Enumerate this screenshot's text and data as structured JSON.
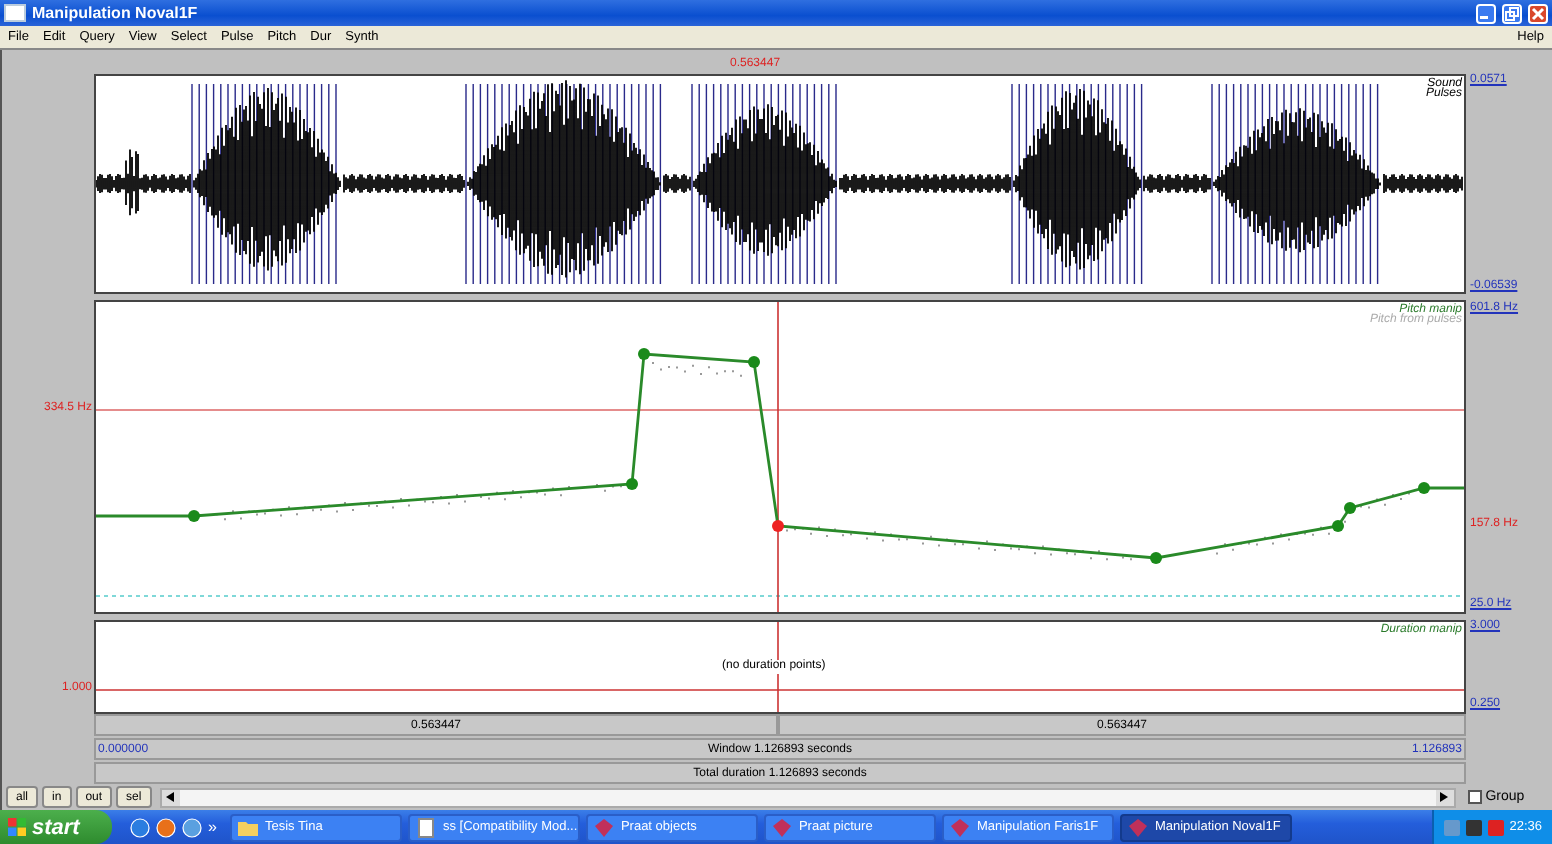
{
  "window": {
    "title": "Manipulation Noval1F"
  },
  "menu": {
    "items": [
      "File",
      "Edit",
      "Query",
      "View",
      "Select",
      "Pulse",
      "Pitch",
      "Dur",
      "Synth"
    ],
    "help": "Help"
  },
  "cursor_time": "0.563447",
  "sound_panel": {
    "labels": [
      "Sound",
      "Pulses"
    ],
    "max": "0.0571",
    "min": "-0.06539"
  },
  "pitch_panel": {
    "labels": [
      "Pitch manip",
      "Pitch from pulses"
    ],
    "max": "601.8 Hz",
    "cursor_value": "334.5 Hz",
    "current": "157.8 Hz",
    "min": "25.0 Hz"
  },
  "duration_panel": {
    "label": "Duration manip",
    "max": "3.000",
    "cursor_value": "1.000",
    "min": "0.250",
    "message": "(no duration points)"
  },
  "time_row": [
    "0.563447",
    "0.563447"
  ],
  "window_row": {
    "start": "0.000000",
    "label": "Window 1.126893 seconds",
    "end": "1.126893"
  },
  "total": "Total duration 1.126893 seconds",
  "zoom_buttons": [
    "all",
    "in",
    "out",
    "sel"
  ],
  "group": {
    "label": "Group",
    "checked": false
  },
  "taskbar": {
    "start": "start",
    "more": "»",
    "items": [
      {
        "label": "Tesis Tina",
        "kind": "folder",
        "selected": false
      },
      {
        "label": "ss [Compatibility Mod...",
        "kind": "document",
        "selected": false
      },
      {
        "label": "Praat objects",
        "kind": "praat",
        "selected": false
      },
      {
        "label": "Praat picture",
        "kind": "praat",
        "selected": false
      },
      {
        "label": "Manipulation Faris1F",
        "kind": "praat",
        "selected": false
      },
      {
        "label": "Manipulation Noval1F",
        "kind": "praat",
        "selected": true
      }
    ],
    "clock": "22:36"
  }
}
